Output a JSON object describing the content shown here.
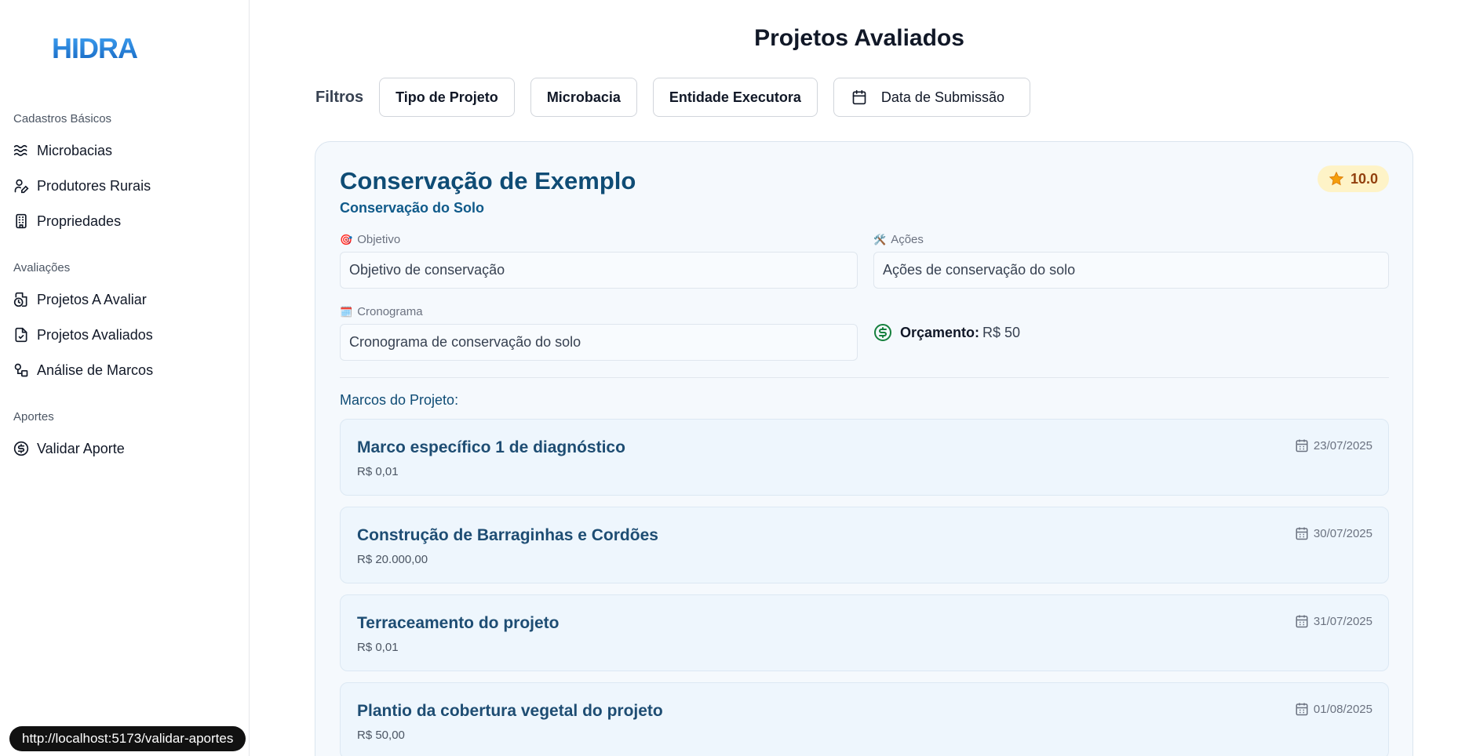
{
  "app": {
    "logo_text": "HIDRA"
  },
  "sidebar": {
    "groups": [
      {
        "title": "Cadastros Básicos",
        "items": [
          {
            "label": "Microbacias",
            "icon": "waves-icon"
          },
          {
            "label": "Produtores Rurais",
            "icon": "user-pen-icon"
          },
          {
            "label": "Propriedades",
            "icon": "building-icon"
          }
        ]
      },
      {
        "title": "Avaliações",
        "items": [
          {
            "label": "Projetos A Avaliar",
            "icon": "file-clock-icon"
          },
          {
            "label": "Projetos Avaliados",
            "icon": "file-check-icon"
          },
          {
            "label": "Análise de Marcos",
            "icon": "shapes-icon"
          }
        ]
      },
      {
        "title": "Aportes",
        "items": [
          {
            "label": "Validar Aporte",
            "icon": "dollar-circle-icon"
          }
        ]
      }
    ]
  },
  "page": {
    "title": "Projetos Avaliados"
  },
  "filters": {
    "label": "Filtros",
    "buttons": [
      "Tipo de Projeto",
      "Microbacia",
      "Entidade Executora"
    ],
    "date_button": "Data de Submissão"
  },
  "project": {
    "title": "Conservação de Exemplo",
    "subtitle": "Conservação do Solo",
    "score": "10.0",
    "objetivo_label": "Objetivo",
    "objetivo_emoji": "🎯",
    "objetivo_value": "Objetivo de conservação",
    "acoes_label": "Ações",
    "acoes_emoji": "🛠️",
    "acoes_value": "Ações de conservação do solo",
    "cronograma_label": "Cronograma",
    "cronograma_emoji": "🗓️",
    "cronograma_value": "Cronograma de conservação do solo",
    "orcamento_label": "Orçamento:",
    "orcamento_value": "R$ 50",
    "marcos_title": "Marcos do Projeto:",
    "milestones": [
      {
        "title": "Marco específico 1 de diagnóstico",
        "value": "R$ 0,01",
        "date": "23/07/2025"
      },
      {
        "title": "Construção de Barraginhas e Cordões",
        "value": "R$ 20.000,00",
        "date": "30/07/2025"
      },
      {
        "title": "Terraceamento do projeto",
        "value": "R$ 0,01",
        "date": "31/07/2025"
      },
      {
        "title": "Plantio da cobertura vegetal do projeto",
        "value": "R$ 50,00",
        "date": "01/08/2025"
      }
    ]
  },
  "status_bar": {
    "url": "http://localhost:5173/validar-aportes"
  },
  "colors": {
    "brand_blue": "#1e88e5",
    "title_navy": "#0f4c75",
    "badge_bg": "#fef3c7"
  }
}
